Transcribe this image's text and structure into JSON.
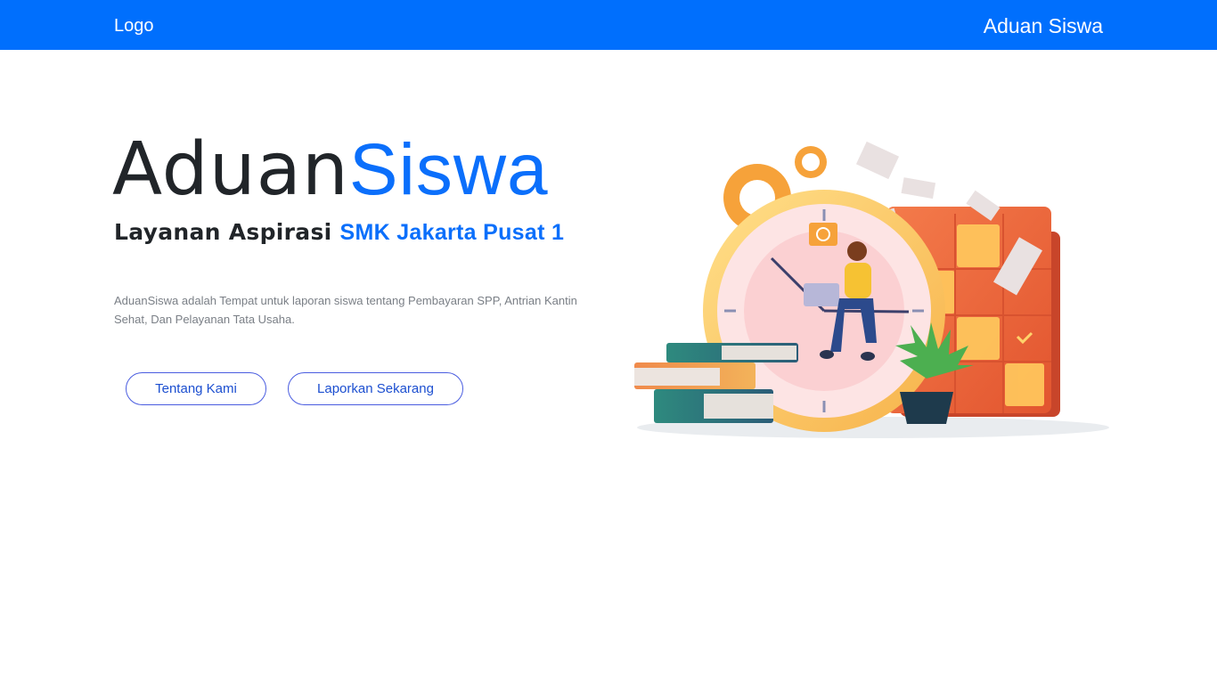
{
  "navbar": {
    "brand": "Logo",
    "title": "Aduan Siswa",
    "background": "#006ffd"
  },
  "hero": {
    "title_part1": "Aduan",
    "title_part2": "Siswa",
    "subtitle_part1": "Layanan Aspirasi ",
    "subtitle_part2": "SMK Jakarta Pusat 1",
    "description": "AduanSiswa adalah Tempat untuk laporan siswa tentang Pembayaran SPP, Antrian Kantin Sehat, Dan Pelayanan Tata Usaha.",
    "accent_color": "#0b6ffb"
  },
  "buttons": {
    "about": "Tentang Kami",
    "report": "Laporkan Sekarang"
  },
  "illustration": {
    "icon": "person-with-laptop-on-clock-illustration"
  }
}
